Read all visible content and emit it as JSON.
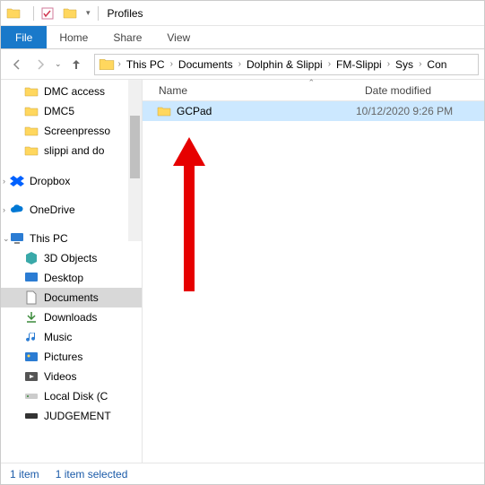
{
  "window": {
    "title": "Profiles"
  },
  "ribbon": {
    "file": "File",
    "tabs": [
      "Home",
      "Share",
      "View"
    ]
  },
  "breadcrumbs": [
    "This PC",
    "Documents",
    "Dolphin & Slippi",
    "FM-Slippi",
    "Sys",
    "Con"
  ],
  "columns": {
    "name": "Name",
    "date": "Date modified"
  },
  "files": [
    {
      "name": "GCPad",
      "date": "10/12/2020 9:26 PM"
    }
  ],
  "sidebar": {
    "quick": [
      {
        "label": "DMC access"
      },
      {
        "label": "DMC5"
      },
      {
        "label": "Screenpresso"
      },
      {
        "label": "slippi and do"
      }
    ],
    "cloud": [
      {
        "label": "Dropbox",
        "icon": "dropbox"
      },
      {
        "label": "OneDrive",
        "icon": "onedrive"
      }
    ],
    "thispc": {
      "label": "This PC"
    },
    "pc": [
      {
        "label": "3D Objects",
        "icon": "3d"
      },
      {
        "label": "Desktop",
        "icon": "desktop"
      },
      {
        "label": "Documents",
        "icon": "documents",
        "selected": true
      },
      {
        "label": "Downloads",
        "icon": "downloads"
      },
      {
        "label": "Music",
        "icon": "music"
      },
      {
        "label": "Pictures",
        "icon": "pictures"
      },
      {
        "label": "Videos",
        "icon": "videos"
      },
      {
        "label": "Local Disk (C",
        "icon": "disk"
      },
      {
        "label": "JUDGEMENT",
        "icon": "disk2"
      }
    ]
  },
  "status": {
    "count": "1 item",
    "selected": "1 item selected"
  }
}
